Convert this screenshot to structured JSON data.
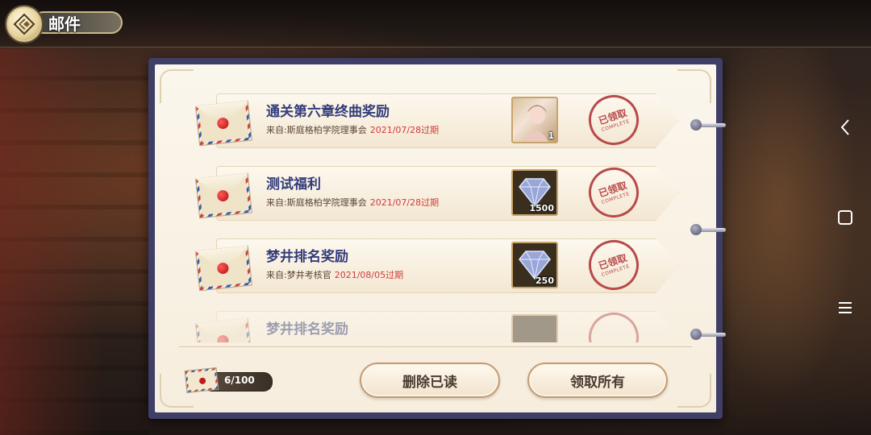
{
  "header": {
    "title": "邮件"
  },
  "mails": [
    {
      "title": "通关第六章终曲奖励",
      "from": "来自:斯庭格柏学院理事会",
      "expire": "2021/07/28过期",
      "reward_type": "card",
      "reward_qty": "1",
      "stamp_main": "已领取",
      "stamp_sub": "COMPLETE"
    },
    {
      "title": "测试福利",
      "from": "来自:斯庭格柏学院理事会",
      "expire": "2021/07/28过期",
      "reward_type": "diamond",
      "reward_qty": "1500",
      "stamp_main": "已领取",
      "stamp_sub": "COMPLETE"
    },
    {
      "title": "梦井排名奖励",
      "from": "来自:梦井考核官",
      "expire": "2021/08/05过期",
      "reward_type": "diamond",
      "reward_qty": "250",
      "stamp_main": "已领取",
      "stamp_sub": "COMPLETE"
    },
    {
      "title": "梦井排名奖励",
      "from": "",
      "expire": "",
      "reward_type": "diamond",
      "reward_qty": "",
      "stamp_main": "",
      "stamp_sub": ""
    }
  ],
  "footer": {
    "mail_count": "6/100",
    "delete_read_label": "删除已读",
    "claim_all_label": "领取所有"
  },
  "system_nav": {
    "icons": [
      "back-icon",
      "home-icon",
      "menu-icon"
    ]
  },
  "colors": {
    "panel_border": "#3e3e66",
    "title_text": "#333c7a",
    "expire_text": "#d23a3a",
    "stamp": "#b84a4a"
  }
}
